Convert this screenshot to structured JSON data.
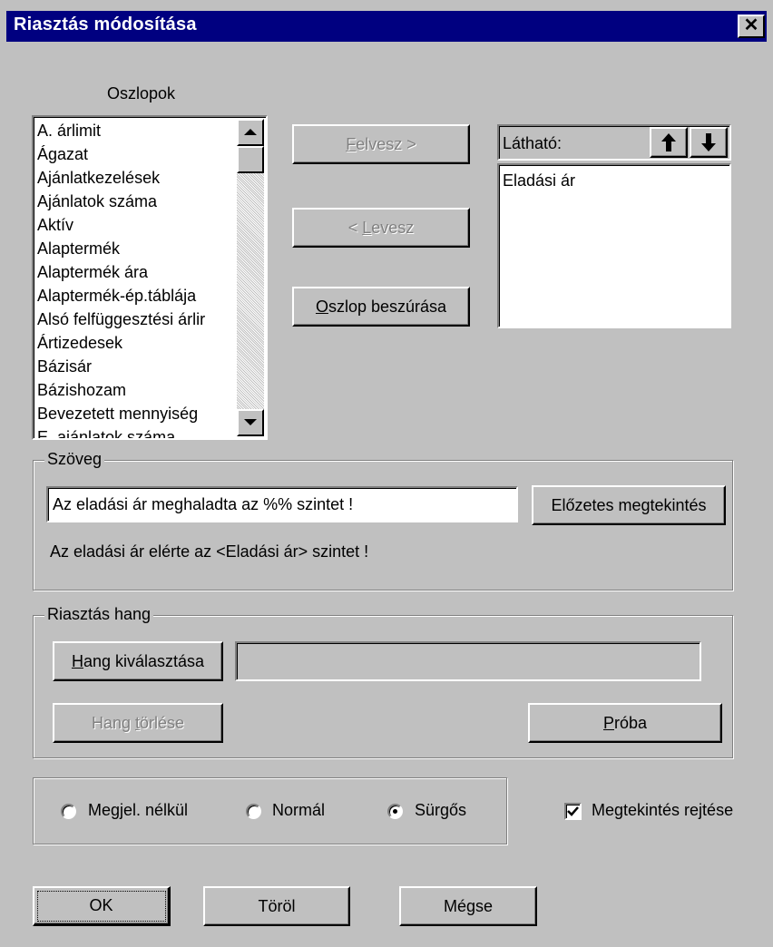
{
  "window": {
    "title": "Riasztás módosítása",
    "close_glyph": "✕"
  },
  "columns": {
    "label": "Oszlopok",
    "items": [
      "A. árlimit",
      "Ágazat",
      "Ajánlatkezelések",
      "Ajánlatok száma",
      "Aktív",
      "Alaptermék",
      "Alaptermék ára",
      "Alaptermék-ép.táblája",
      "Alsó felfüggesztési árlir",
      "Ártizedesek",
      "Bázisár",
      "Bázishozam",
      "Bevezetett mennyiség",
      "E. ajánlatok száma"
    ]
  },
  "buttons": {
    "add": {
      "key": "F",
      "rest": "elvesz >"
    },
    "remove": {
      "pre": "< ",
      "key": "L",
      "rest": "evesz"
    },
    "insert_column": {
      "key": "O",
      "rest": "szlop beszúrása"
    },
    "preview": "Előzetes megtekintés",
    "select_sound": {
      "key": "H",
      "rest": "ang kiválasztása"
    },
    "delete_sound": {
      "pre": "Hang ",
      "key": "t",
      "rest": "örlése"
    },
    "test": {
      "key": "P",
      "rest": "róba"
    },
    "ok": "OK",
    "delete": "Töröl",
    "cancel": "Mégse"
  },
  "visible": {
    "label": "Látható:",
    "up_icon": "arrow-up",
    "down_icon": "arrow-down",
    "items": [
      "Eladási ár"
    ]
  },
  "text_group": {
    "title": "Szöveg",
    "input_value": "Az eladási ár meghaladta az %% szintet !",
    "preview_text": "Az eladási ár elérte az <Eladási ár> szintet !"
  },
  "sound_group": {
    "title": "Riasztás hang",
    "file_value": ""
  },
  "priority": {
    "options": [
      {
        "label": "Megjel. nélkül",
        "selected": false
      },
      {
        "label": "Normál",
        "selected": false
      },
      {
        "label": "Sürgős",
        "selected": true
      }
    ]
  },
  "hide_preview": {
    "label": "Megtekintés rejtése",
    "checked": true
  }
}
